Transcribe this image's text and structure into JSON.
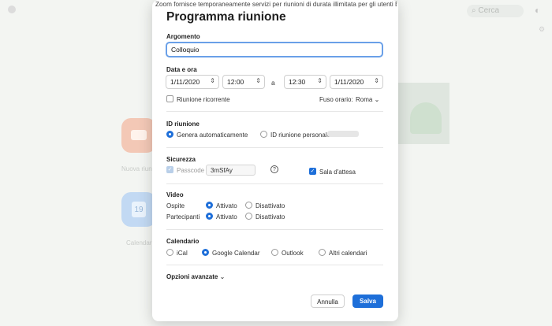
{
  "background": {
    "search_placeholder": "Cerca",
    "tile1_label": "Nuova riunione",
    "tile2_label": "Calendario",
    "tile2_date": "19"
  },
  "dialog": {
    "notice": "Zoom fornisce temporaneamente servizi per riunioni di durata illimitata per gli utenti Base",
    "title": "Programma riunione",
    "topic": {
      "label": "Argomento",
      "value": "Colloquio"
    },
    "datetime": {
      "label": "Data e ora",
      "start_date": "1/11/2020",
      "start_time": "12:00",
      "to_label": "a",
      "end_time": "12:30",
      "end_date": "1/11/2020",
      "recurring_label": "Riunione ricorrente",
      "timezone_label": "Fuso orario:",
      "timezone_value": "Roma"
    },
    "meeting_id": {
      "label": "ID riunione",
      "auto_label": "Genera automaticamente",
      "personal_label": "ID riunione personale"
    },
    "security": {
      "label": "Sicurezza",
      "passcode_label": "Passcode",
      "passcode_value": "3mSfAy",
      "waiting_room_label": "Sala d'attesa"
    },
    "video": {
      "label": "Video",
      "host_label": "Ospite",
      "participants_label": "Partecipanti",
      "on_label": "Attivato",
      "off_label": "Disattivato"
    },
    "calendar": {
      "label": "Calendario",
      "options": [
        "iCal",
        "Google Calendar",
        "Outlook",
        "Altri calendari"
      ],
      "selected": "Google Calendar"
    },
    "advanced_label": "Opzioni avanzate",
    "cancel_label": "Annulla",
    "save_label": "Salva"
  },
  "colors": {
    "accent": "#1e6fd9",
    "focus_ring": "#6aa0e8"
  }
}
